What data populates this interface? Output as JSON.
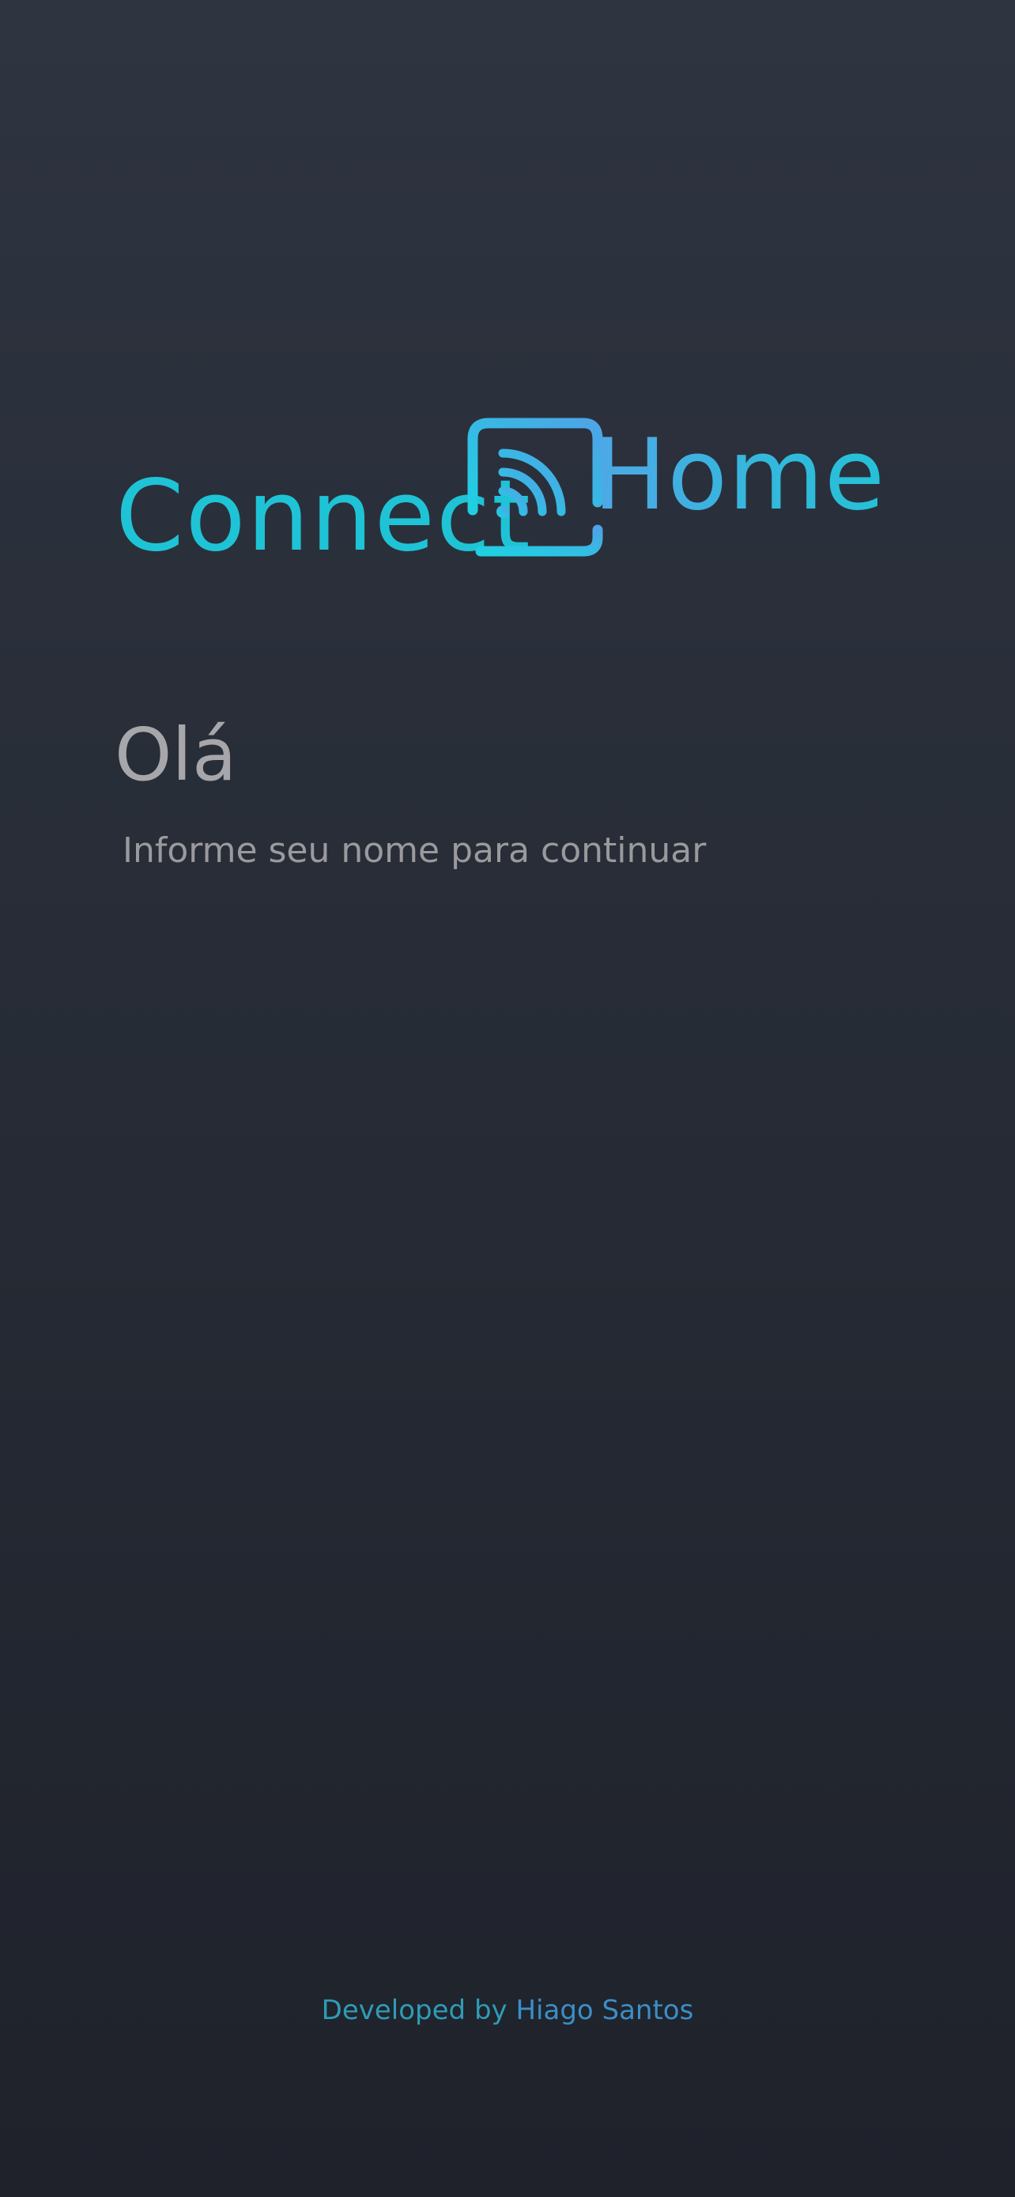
{
  "logo": {
    "part1": "Connect",
    "part2": "Home",
    "icon": "wifi-cast-icon",
    "colors": {
      "connect": "#1fc3d6",
      "home_start": "#4ea8e6",
      "home_end": "#24c2d7"
    }
  },
  "greeting": {
    "title": "Olá",
    "subtitle": "Informe seu nome para continuar"
  },
  "name_input": {
    "value": "",
    "placeholder": ""
  },
  "footer": {
    "prefix": "Developed by ",
    "author": "Hiago Santos"
  },
  "theme": {
    "background_top": "#2e3440",
    "background_bottom": "#1f222b",
    "accent": "#1fc3d6"
  }
}
